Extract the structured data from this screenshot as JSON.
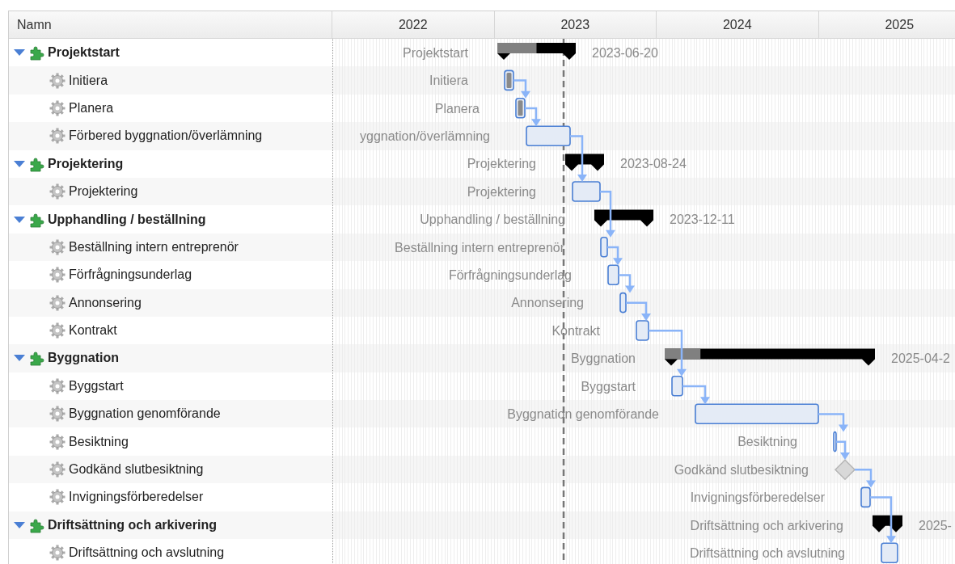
{
  "columns": {
    "name": "Namn"
  },
  "timeline": {
    "years": [
      "2022",
      "2023",
      "2024",
      "2025"
    ]
  },
  "tasks": [
    {
      "name": "Projektstart",
      "kind": "summary",
      "expanded": true,
      "chart_label": "Projektstart",
      "end_label": "2023-06-20",
      "children": [
        {
          "name": "Initiera",
          "kind": "task",
          "chart_label": "Initiera"
        },
        {
          "name": "Planera",
          "kind": "task",
          "chart_label": "Planera"
        },
        {
          "name": "Förbered byggnation/överlämning",
          "kind": "task",
          "chart_label": "yggnation/överlämning"
        }
      ]
    },
    {
      "name": "Projektering",
      "kind": "summary",
      "expanded": true,
      "chart_label": "Projektering",
      "end_label": "2023-08-24",
      "children": [
        {
          "name": "Projektering",
          "kind": "task",
          "chart_label": "Projektering"
        }
      ]
    },
    {
      "name": "Upphandling / beställning",
      "kind": "summary",
      "expanded": true,
      "chart_label": "Upphandling / beställning",
      "end_label": "2023-12-11",
      "children": [
        {
          "name": "Beställning intern entreprenör",
          "kind": "task",
          "chart_label": "Beställning intern entreprenör"
        },
        {
          "name": "Förfrågningsunderlag",
          "kind": "task",
          "chart_label": "Förfrågningsunderlag"
        },
        {
          "name": "Annonsering",
          "kind": "task",
          "chart_label": "Annonsering"
        },
        {
          "name": "Kontrakt",
          "kind": "task",
          "chart_label": "Kontrakt"
        }
      ]
    },
    {
      "name": "Byggnation",
      "kind": "summary",
      "expanded": true,
      "chart_label": "Byggnation",
      "end_label": "2025-04-2",
      "children": [
        {
          "name": "Byggstart",
          "kind": "task",
          "chart_label": "Byggstart"
        },
        {
          "name": "Byggnation genomförande",
          "kind": "task",
          "chart_label": "Byggnation genomförande"
        },
        {
          "name": "Besiktning",
          "kind": "task",
          "chart_label": "Besiktning"
        },
        {
          "name": "Godkänd slutbesiktning",
          "kind": "milestone",
          "chart_label": "Godkänd slutbesiktning"
        },
        {
          "name": "Invigningsförberedelser",
          "kind": "task",
          "chart_label": "Invigningsförberedelser"
        }
      ]
    },
    {
      "name": "Driftsättning och arkivering",
      "kind": "summary",
      "expanded": true,
      "chart_label": "Driftsättning och arkivering",
      "end_label": "2025-",
      "children": [
        {
          "name": "Driftsättning och avslutning",
          "kind": "task",
          "chart_label": "Driftsättning och avslutning"
        }
      ]
    }
  ]
}
